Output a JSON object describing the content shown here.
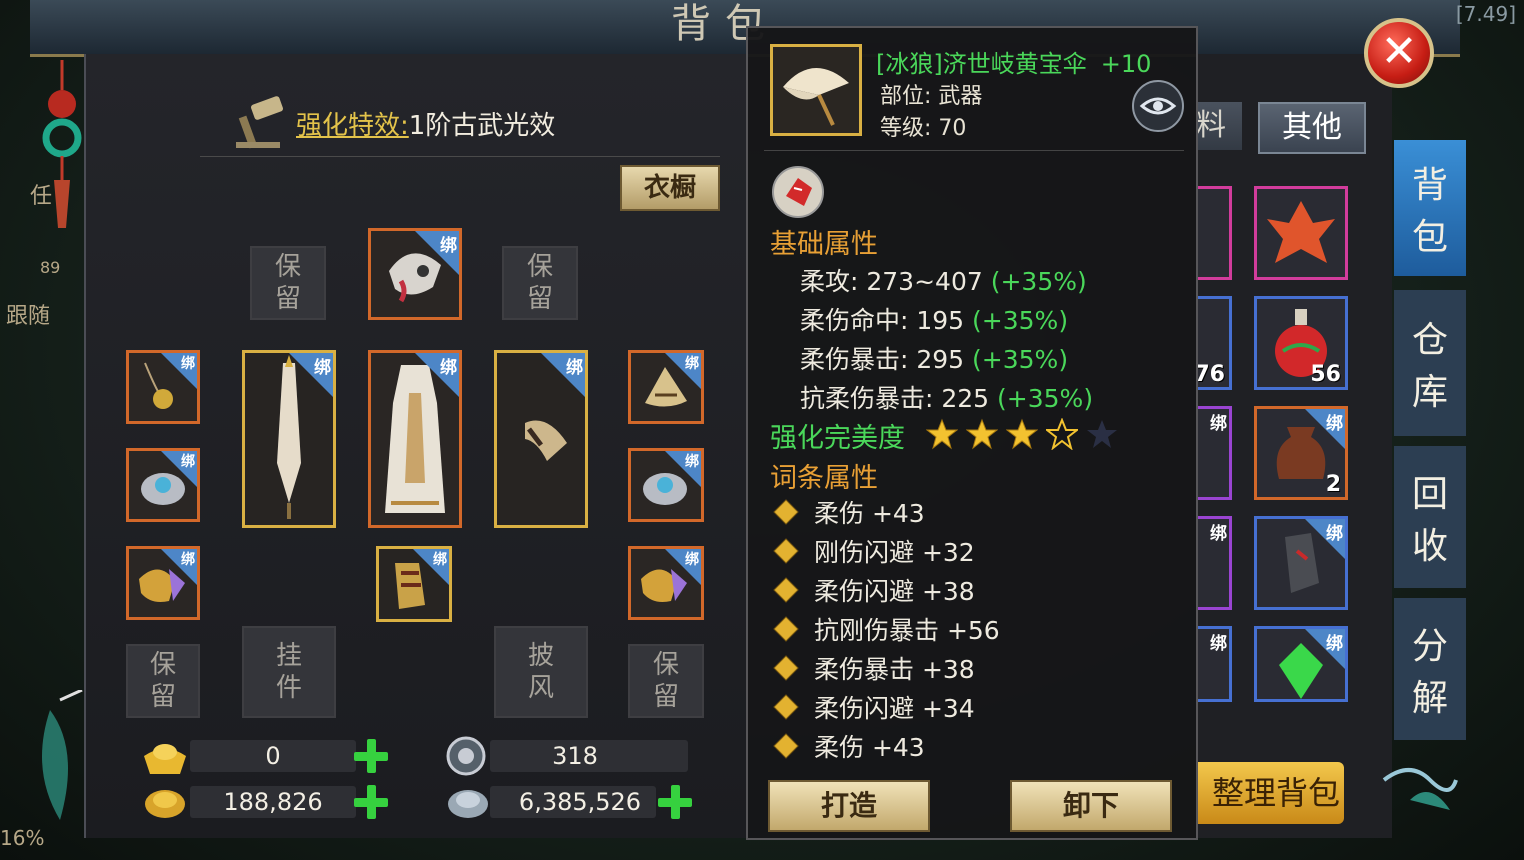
{
  "window": {
    "title": "背包",
    "top_right_text": "[7.49]",
    "left_edge_texts": [
      "任",
      "89",
      "跟随",
      "16%"
    ]
  },
  "equip_panel": {
    "effect_label": "强化特效:",
    "effect_value": "1阶古武光效",
    "wardrobe_button": "衣橱",
    "bind_label": "绑",
    "reserved_label_1": "保",
    "reserved_label_2": "留",
    "pendant_label_1": "挂",
    "pendant_label_2": "件",
    "cloak_label_1": "披",
    "cloak_label_2": "风"
  },
  "currency": {
    "gold_ingot": "0",
    "gold_coin": "188,826",
    "token": "318",
    "silver": "6,385,526"
  },
  "tooltip": {
    "item_name": "[冰狼]济世岐黄宝伞",
    "enhance_level": "+10",
    "slot_line": "部位: 武器",
    "level_line": "等级: 70",
    "base_attr_title": "基础属性",
    "stats": [
      {
        "label": "柔攻: 273~407",
        "bonus": "(+35%)"
      },
      {
        "label": "柔伤命中: 195",
        "bonus": "(+35%)"
      },
      {
        "label": "柔伤暴击: 295",
        "bonus": "(+35%)"
      },
      {
        "label": "抗柔伤暴击: 225",
        "bonus": "(+35%)"
      }
    ],
    "perfection_title": "强化完美度",
    "perfection_stars": 3,
    "perfection_max": 4,
    "affix_title": "词条属性",
    "affixes": [
      "柔伤 +43",
      "刚伤闪避 +32",
      "柔伤闪避 +38",
      "抗刚伤暴击 +56",
      "柔伤暴击 +38",
      "柔伤闪避 +34",
      "柔伤 +43"
    ],
    "btn_forge": "打造",
    "btn_unequip": "卸下"
  },
  "inventory": {
    "tab_partial": "料",
    "tab_other": "其他",
    "counts": [
      "76",
      "56",
      "2"
    ],
    "bind_label": "绑",
    "sort_button": "整理背包"
  },
  "side_tabs": [
    {
      "line1": "背",
      "line2": "包"
    },
    {
      "line1": "仓",
      "line2": "库"
    },
    {
      "line1": "回",
      "line2": "收"
    },
    {
      "line1": "分",
      "line2": "解"
    }
  ],
  "close_symbol": "✕",
  "colors": {
    "enhance_green": "#4ad75a",
    "section_orange": "#e8a035",
    "bind_blue": "#4d86c7"
  }
}
